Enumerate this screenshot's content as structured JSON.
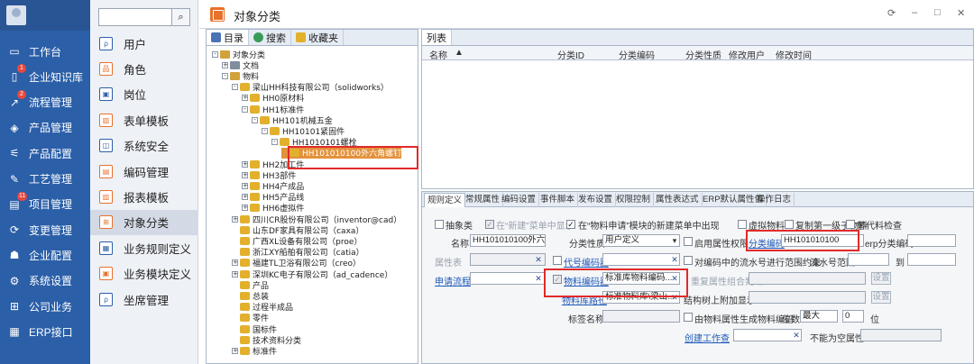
{
  "left_nav": {
    "items": [
      {
        "label": "工作台",
        "icon": "monitor-icon",
        "badge": ""
      },
      {
        "label": "企业知识库",
        "icon": "book-icon",
        "badge": "1"
      },
      {
        "label": "流程管理",
        "icon": "flow-icon",
        "badge": "2"
      },
      {
        "label": "产品管理",
        "icon": "cube-icon",
        "badge": ""
      },
      {
        "label": "产品配置",
        "icon": "sliders-icon",
        "badge": ""
      },
      {
        "label": "工艺管理",
        "icon": "tool-icon",
        "badge": ""
      },
      {
        "label": "项目管理",
        "icon": "project-icon",
        "badge": "11"
      },
      {
        "label": "变更管理",
        "icon": "change-icon",
        "badge": ""
      },
      {
        "label": "企业配置",
        "icon": "users-icon",
        "badge": ""
      },
      {
        "label": "系统设置",
        "icon": "gear-icon",
        "badge": ""
      },
      {
        "label": "公司业务",
        "icon": "grid-icon",
        "badge": ""
      },
      {
        "label": "ERP接口",
        "icon": "apps-icon",
        "badge": ""
      }
    ]
  },
  "sub_nav": {
    "search_placeholder": "",
    "items": [
      {
        "label": "用户"
      },
      {
        "label": "角色"
      },
      {
        "label": "岗位"
      },
      {
        "label": "表单模板"
      },
      {
        "label": "系统安全"
      },
      {
        "label": "编码管理"
      },
      {
        "label": "报表模板"
      },
      {
        "label": "对象分类"
      },
      {
        "label": "业务规则定义"
      },
      {
        "label": "业务模块定义"
      },
      {
        "label": "坐席管理"
      }
    ]
  },
  "header": {
    "title": "对象分类",
    "win_controls": [
      "⟳",
      "–",
      "□",
      "✕"
    ]
  },
  "tree_tabs": [
    "目录",
    "搜索",
    "收藏夹"
  ],
  "tree": [
    {
      "label": "对象分类",
      "depth": 0,
      "exp": "-"
    },
    {
      "label": "文档",
      "depth": 1,
      "exp": "+"
    },
    {
      "label": "物料",
      "depth": 1,
      "exp": "-"
    },
    {
      "label": "梁山HH科技有限公司（solidworks）",
      "depth": 2,
      "exp": "-"
    },
    {
      "label": "HH0原材料",
      "depth": 3,
      "exp": "+"
    },
    {
      "label": "HH1标准件",
      "depth": 3,
      "exp": "-"
    },
    {
      "label": "HH101机械五金",
      "depth": 4,
      "exp": "-"
    },
    {
      "label": "HH10101紧固件",
      "depth": 5,
      "exp": "-"
    },
    {
      "label": "HH1010101螺栓",
      "depth": 6,
      "exp": "-"
    },
    {
      "label": "HH101010100外六角螺钉",
      "depth": 7,
      "exp": ""
    },
    {
      "label": "HH2加工件",
      "depth": 3,
      "exp": "+"
    },
    {
      "label": "HH3部件",
      "depth": 3,
      "exp": "+"
    },
    {
      "label": "HH4产成品",
      "depth": 3,
      "exp": "+"
    },
    {
      "label": "HH5产品线",
      "depth": 3,
      "exp": "+"
    },
    {
      "label": "HH6虚拟件",
      "depth": 3,
      "exp": "+"
    },
    {
      "label": "四川CR股份有限公司（inventor@cad）",
      "depth": 2,
      "exp": "+"
    },
    {
      "label": "山东DF家具有限公司（caxa）",
      "depth": 2,
      "exp": ""
    },
    {
      "label": "广西XL设备有限公司（proe）",
      "depth": 2,
      "exp": ""
    },
    {
      "label": "浙江XY船舶有限公司（catia）",
      "depth": 2,
      "exp": ""
    },
    {
      "label": "福建TL卫浴有限公司（creo）",
      "depth": 2,
      "exp": "+"
    },
    {
      "label": "深圳KC电子有限公司（ad_cadence）",
      "depth": 2,
      "exp": "+"
    },
    {
      "label": "产品",
      "depth": 2,
      "exp": ""
    },
    {
      "label": "总装",
      "depth": 2,
      "exp": ""
    },
    {
      "label": "过程半成品",
      "depth": 2,
      "exp": ""
    },
    {
      "label": "零件",
      "depth": 2,
      "exp": ""
    },
    {
      "label": "国标件",
      "depth": 2,
      "exp": ""
    },
    {
      "label": "技术资料分类",
      "depth": 2,
      "exp": ""
    },
    {
      "label": "标准件",
      "depth": 2,
      "exp": "+"
    }
  ],
  "list": {
    "tab": "列表",
    "columns": [
      "名称",
      "分类ID",
      "分类编码",
      "分类性质",
      "修改用户",
      "修改时间"
    ]
  },
  "props": {
    "tabs": [
      "规则定义",
      "常规属性",
      "编码设置",
      "事件脚本",
      "发布设置",
      "权限控制",
      "属性表达式",
      "ERP默认属性值",
      "操作日志"
    ],
    "cb_abstract": "抽象类",
    "cb_new_menu": "在“新建”菜单中显示",
    "cb_request": "在“物料申请”模块的新建菜单中出现",
    "cb_virtual": "虚拟物料",
    "cb_copy_first": "复制第一级子物料",
    "cb_sub_check": "替代料检查",
    "name_label": "名称",
    "name_value": "HH101010100外六角螺",
    "nature_label": "分类性质",
    "nature_value": "用户定义",
    "cb_enable_perm": "启用属性权限",
    "code_label": "分类编码",
    "code_value": "HH101010100",
    "erp_label": "erp分类编码",
    "attr_table_label": "属性表",
    "code_rule_label": "代号编码器",
    "cb_scope": "对编码中的流水号进行范围约束",
    "serial_range_label": "流水号范围",
    "to_label": "到",
    "workflow_label": "申请流程",
    "material_encoder_label": "物料编码器",
    "material_encoder_value": "标准库物料编码...",
    "repeat_judge_label": "重复属性组合判断",
    "setting_btn": "设置",
    "library_path_label": "物料库路径",
    "library_path_value": "标准物料库\\梁山...",
    "struct_tree_label": "结构树上附加显示",
    "tag_name_label": "标签名称",
    "cb_gen_code": "由物料属性生成物料编码",
    "digits_label": "位数",
    "digits_value": "最大",
    "digits_num": "0",
    "digits_unit": "位",
    "create_ws_label": "创建工作查",
    "not_empty_label": "不能为空属性"
  }
}
